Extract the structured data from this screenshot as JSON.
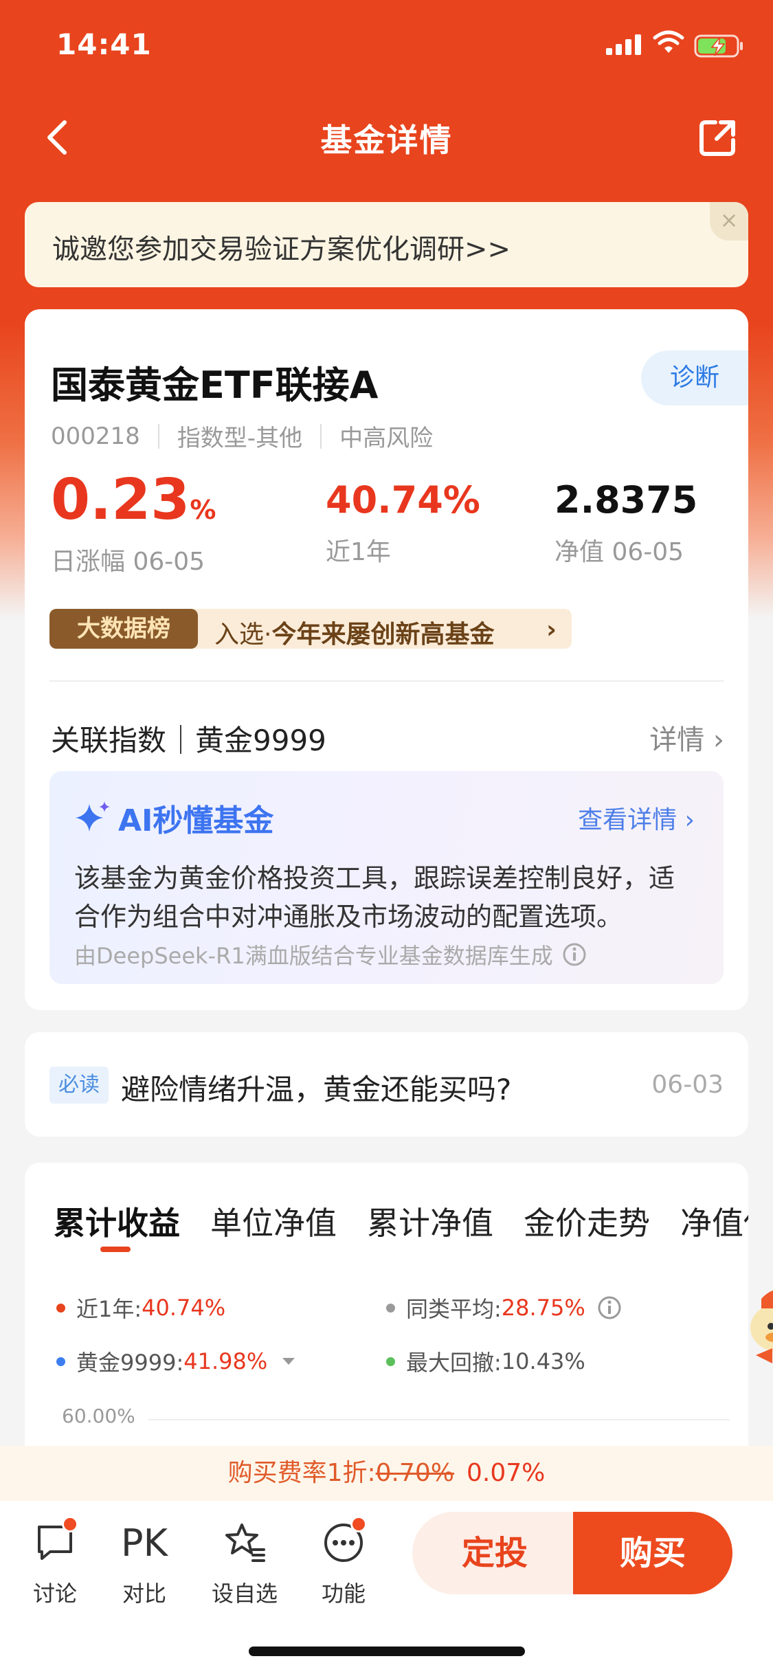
{
  "status_bar": {
    "time": "14:41"
  },
  "nav": {
    "title": "基金详情"
  },
  "banner": {
    "text": "诚邀您参加交易验证方案优化调研>>",
    "close": "×"
  },
  "fund": {
    "name": "国泰黄金ETF联接A",
    "diagnose": "诊断",
    "code": "000218",
    "type": "指数型-其他",
    "risk": "中高风险",
    "daily_change": "0.23",
    "daily_change_unit": "%",
    "daily_label": "日涨幅 06-05",
    "year_return": "40.74%",
    "year_label": "近1年",
    "nav": "2.8375",
    "nav_label": "净值 06-05",
    "bigdata_tag": "大数据榜",
    "bigdata_prefix": "入选·",
    "bigdata_text": "今年来屡创新高基金",
    "bigdata_arrow": "›"
  },
  "index": {
    "label": "关联指数｜黄金9999",
    "detail": "详情 ›"
  },
  "ai": {
    "title": "AI秒懂基金",
    "more": "查看详情 ›",
    "desc": "该基金为黄金价格投资工具，跟踪误差控制良好，适合作为组合中对冲通胀及市场波动的配置选项。",
    "source": "由DeepSeek-R1满血版结合专业基金数据库生成"
  },
  "news": {
    "tag": "必读",
    "title": "避险情绪升温，黄金还能买吗?",
    "date": "06-03"
  },
  "chart_tabs": [
    "累计收益",
    "单位净值",
    "累计净值",
    "金价走势",
    "净值估算"
  ],
  "legend": [
    {
      "label": "近1年:",
      "value": "40.74%",
      "color": "#e8441d"
    },
    {
      "label": "同类平均:",
      "value": "28.75%",
      "color": "#9a9a9a"
    },
    {
      "label": "黄金9999:",
      "value": "41.98%",
      "color": "#3d7ff0"
    },
    {
      "label": "最大回撤:",
      "value": "10.43%",
      "color": "#5cbf5c"
    }
  ],
  "chart_axis": {
    "top_label": "60.00%"
  },
  "fee": {
    "prefix": "购买费率1折:",
    "old": "0.70%",
    "new": "0.07%"
  },
  "bottom_bar": {
    "discuss": "讨论",
    "pk_glyph": "PK",
    "compare": "对比",
    "watchlist": "设自选",
    "functions": "功能",
    "plan": "定投",
    "buy": "购买"
  },
  "colors": {
    "brand": "#e8441d",
    "up": "#e8371e",
    "ai": "#3d74f0"
  }
}
